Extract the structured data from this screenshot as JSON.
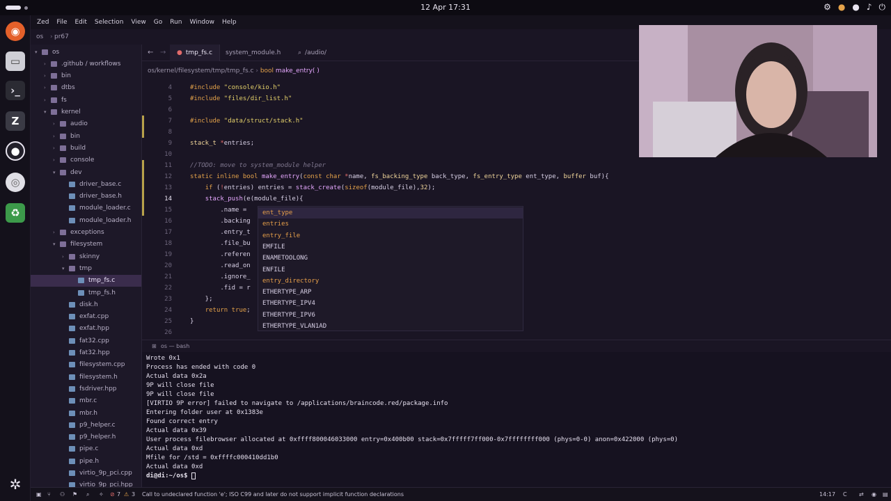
{
  "system_bar": {
    "clock": "12 Apr  17:31",
    "tray_icons": [
      "steam-icon",
      "mic-icon",
      "mic-icon",
      "volume-icon",
      "power-icon"
    ]
  },
  "menubar": {
    "items": [
      "Zed",
      "File",
      "Edit",
      "Selection",
      "View",
      "Go",
      "Run",
      "Window",
      "Help"
    ]
  },
  "project": {
    "name": "os",
    "branch": "pr67"
  },
  "sidebar": {
    "items": [
      {
        "label": "os",
        "depth": 0,
        "kind": "folder-open"
      },
      {
        "label": ".github / workflows",
        "depth": 1,
        "kind": "folder"
      },
      {
        "label": "bin",
        "depth": 1,
        "kind": "folder"
      },
      {
        "label": "dtbs",
        "depth": 1,
        "kind": "folder"
      },
      {
        "label": "fs",
        "depth": 1,
        "kind": "folder"
      },
      {
        "label": "kernel",
        "depth": 1,
        "kind": "folder-open"
      },
      {
        "label": "audio",
        "depth": 2,
        "kind": "folder"
      },
      {
        "label": "bin",
        "depth": 2,
        "kind": "folder"
      },
      {
        "label": "build",
        "depth": 2,
        "kind": "folder"
      },
      {
        "label": "console",
        "depth": 2,
        "kind": "folder"
      },
      {
        "label": "dev",
        "depth": 2,
        "kind": "folder-open"
      },
      {
        "label": "driver_base.c",
        "depth": 3,
        "kind": "file"
      },
      {
        "label": "driver_base.h",
        "depth": 3,
        "kind": "file"
      },
      {
        "label": "module_loader.c",
        "depth": 3,
        "kind": "file"
      },
      {
        "label": "module_loader.h",
        "depth": 3,
        "kind": "file"
      },
      {
        "label": "exceptions",
        "depth": 2,
        "kind": "folder"
      },
      {
        "label": "filesystem",
        "depth": 2,
        "kind": "folder-open"
      },
      {
        "label": "skinny",
        "depth": 3,
        "kind": "folder"
      },
      {
        "label": "tmp",
        "depth": 3,
        "kind": "folder-open"
      },
      {
        "label": "tmp_fs.c",
        "depth": 4,
        "kind": "file",
        "selected": true
      },
      {
        "label": "tmp_fs.h",
        "depth": 4,
        "kind": "file"
      },
      {
        "label": "disk.h",
        "depth": 3,
        "kind": "file"
      },
      {
        "label": "exfat.cpp",
        "depth": 3,
        "kind": "file"
      },
      {
        "label": "exfat.hpp",
        "depth": 3,
        "kind": "file"
      },
      {
        "label": "fat32.cpp",
        "depth": 3,
        "kind": "file"
      },
      {
        "label": "fat32.hpp",
        "depth": 3,
        "kind": "file"
      },
      {
        "label": "filesystem.cpp",
        "depth": 3,
        "kind": "file"
      },
      {
        "label": "filesystem.h",
        "depth": 3,
        "kind": "file"
      },
      {
        "label": "fsdriver.hpp",
        "depth": 3,
        "kind": "file"
      },
      {
        "label": "mbr.c",
        "depth": 3,
        "kind": "file"
      },
      {
        "label": "mbr.h",
        "depth": 3,
        "kind": "file"
      },
      {
        "label": "p9_helper.c",
        "depth": 3,
        "kind": "file"
      },
      {
        "label": "p9_helper.h",
        "depth": 3,
        "kind": "file"
      },
      {
        "label": "pipe.c",
        "depth": 3,
        "kind": "file"
      },
      {
        "label": "pipe.h",
        "depth": 3,
        "kind": "file"
      },
      {
        "label": "virtio_9p_pci.cpp",
        "depth": 3,
        "kind": "file"
      },
      {
        "label": "virtio_9p_pci.hpp",
        "depth": 3,
        "kind": "file"
      }
    ]
  },
  "tabs": [
    {
      "label": "tmp_fs.c",
      "active": true
    },
    {
      "label": "system_module.h",
      "active": false
    },
    {
      "label": "/audio/",
      "active": false
    }
  ],
  "breadcrumb": {
    "path": "os/kernel/filesystem/tmp/tmp_fs.c",
    "symbol_type": "bool",
    "symbol": "make_entry( )"
  },
  "editor": {
    "current_line": "14",
    "lines": [
      {
        "n": "4",
        "tokens": [
          [
            "k",
            "#include "
          ],
          [
            "s",
            "\"console/kio.h\""
          ]
        ]
      },
      {
        "n": "5",
        "tokens": [
          [
            "k",
            "#include "
          ],
          [
            "s",
            "\"files/dir_list.h\""
          ]
        ]
      },
      {
        "n": "6",
        "tokens": []
      },
      {
        "n": "7",
        "tokens": [
          [
            "k",
            "#include "
          ],
          [
            "s",
            "\"data/struct/stack.h\""
          ]
        ]
      },
      {
        "n": "8",
        "tokens": []
      },
      {
        "n": "9",
        "tokens": [
          [
            "t",
            "stack_t "
          ],
          [
            "p",
            "*"
          ],
          [
            "",
            "entries;"
          ]
        ]
      },
      {
        "n": "10",
        "tokens": []
      },
      {
        "n": "11",
        "tokens": [
          [
            "c",
            "//TODO: move to system_module helper"
          ]
        ]
      },
      {
        "n": "12",
        "tokens": [
          [
            "k",
            "static inline bool "
          ],
          [
            "f",
            "make_entry"
          ],
          [
            "",
            "("
          ],
          [
            "k",
            "const char "
          ],
          [
            "p",
            "*"
          ],
          [
            "",
            "name, "
          ],
          [
            "t",
            "fs_backing_type "
          ],
          [
            "",
            "back_type, "
          ],
          [
            "t",
            "fs_entry_type "
          ],
          [
            "",
            "ent_type, "
          ],
          [
            "t",
            "buffer "
          ],
          [
            "",
            "buf){"
          ]
        ]
      },
      {
        "n": "13",
        "tokens": [
          [
            "",
            "    "
          ],
          [
            "k",
            "if "
          ],
          [
            "",
            "("
          ],
          [
            "p",
            "!"
          ],
          [
            "",
            "entries) entries = "
          ],
          [
            "f",
            "stack_create"
          ],
          [
            "",
            "("
          ],
          [
            "k",
            "sizeof"
          ],
          [
            "",
            "(module_file),"
          ],
          [
            "t",
            "32"
          ],
          [
            "",
            "); "
          ]
        ]
      },
      {
        "n": "14",
        "tokens": [
          [
            "",
            "    "
          ],
          [
            "f",
            "stack_push"
          ],
          [
            "",
            "(e(module_file){"
          ]
        ]
      },
      {
        "n": "15",
        "tokens": [
          [
            "",
            "        .name = "
          ]
        ]
      },
      {
        "n": "16",
        "tokens": [
          [
            "",
            "        .backing"
          ]
        ]
      },
      {
        "n": "17",
        "tokens": [
          [
            "",
            "        .entry_t"
          ]
        ]
      },
      {
        "n": "18",
        "tokens": [
          [
            "",
            "        .file_bu"
          ]
        ]
      },
      {
        "n": "19",
        "tokens": [
          [
            "",
            "        .referen"
          ]
        ]
      },
      {
        "n": "20",
        "tokens": [
          [
            "",
            "        .read_on"
          ]
        ]
      },
      {
        "n": "21",
        "tokens": [
          [
            "",
            "        .ignore_"
          ]
        ]
      },
      {
        "n": "22",
        "tokens": [
          [
            "",
            "        .fid = r"
          ]
        ]
      },
      {
        "n": "23",
        "tokens": [
          [
            "",
            "    };"
          ]
        ]
      },
      {
        "n": "24",
        "tokens": [
          [
            "",
            "    "
          ],
          [
            "k",
            "return true"
          ],
          [
            "",
            ";"
          ]
        ]
      },
      {
        "n": "25",
        "tokens": [
          [
            "",
            "}"
          ]
        ]
      },
      {
        "n": "26",
        "tokens": []
      }
    ]
  },
  "completion": {
    "items": [
      {
        "label": "ent_type",
        "style": "lc",
        "selected": true
      },
      {
        "label": "entries",
        "style": "lc"
      },
      {
        "label": "entry_file",
        "style": "lc"
      },
      {
        "label": "EMFILE",
        "style": "uc"
      },
      {
        "label": "ENAMETOOLONG",
        "style": "uc"
      },
      {
        "label": "ENFILE",
        "style": "uc"
      },
      {
        "label": "entry_directory",
        "style": "lc"
      },
      {
        "label": "ETHERTYPE_ARP",
        "style": "uc"
      },
      {
        "label": "ETHERTYPE_IPV4",
        "style": "uc"
      },
      {
        "label": "ETHERTYPE_IPV6",
        "style": "uc"
      },
      {
        "label": "ETHERTYPE_VLAN1AD",
        "style": "uc"
      }
    ]
  },
  "terminal": {
    "tab_label": "os — bash",
    "lines": [
      "Wrote 0x1",
      "Process has ended with code 0",
      "Actual data 0x2a",
      "9P will close file",
      "9P will close file",
      "[VIRTIO 9P error] failed to navigate to /applications/braincode.red/package.info",
      "Entering folder user at 0x1383e",
      "Found correct entry",
      "Actual data 0x39",
      "User process filebrowser allocated at 0xffff800046033000 entry=0x400b00 stack=0x7fffff7ff000-0x7ffffffff000 (phys=0-0) anon=0x422000 (phys=0)",
      "Actual data 0xd",
      "Mfile for /std = 0xffffc000410dd1b0",
      "Actual data 0xd"
    ],
    "prompt": "di@di:~/os$ "
  },
  "statusbar": {
    "errors": "7",
    "warnings": "3",
    "message": "Call to undeclared function 'e'; ISO C99 and later do not support implicit function declarations",
    "cursor_pos": "14:17",
    "language": "C"
  },
  "colors": {
    "accent": "#e26b6b",
    "selection": "#3a2c4c",
    "background": "#1a1524"
  }
}
